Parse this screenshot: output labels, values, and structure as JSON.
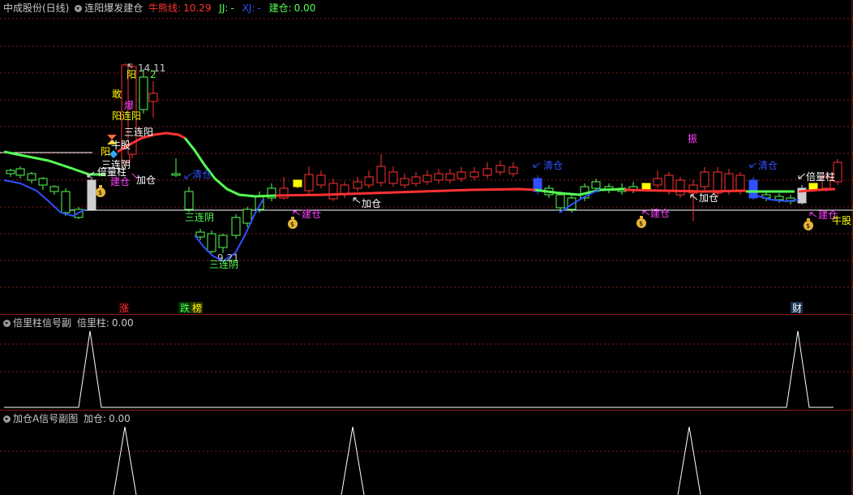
{
  "main": {
    "stock_name": "中成股份(日线)",
    "indicator_name": "连阳爆发建仓",
    "niu_label": "牛熊线:",
    "niu_value": "10.29",
    "jj_label": "JJ:",
    "jj_value": "-",
    "xj_label": "XJ:",
    "xj_value": "-",
    "jiancang_label": "建仓:",
    "jiancang_value": "0.00",
    "price_high_label": "14.11",
    "price_low_label": "9.21",
    "annotations": {
      "lian_yang": "三连阳",
      "lian_yin": "三连阴",
      "niu_gu": "牛股",
      "yang": "阳",
      "bei_liang_zhu": "倍量柱",
      "jian_cang": "建仓",
      "jia_cang": "加仓",
      "qing_cang": "清仓",
      "zhen": "振",
      "bao": "爆",
      "gan": "敢",
      "yang_lian_yang": "阳连阳",
      "er": "2",
      "yang_char": "阳"
    },
    "bottom_tags": {
      "zhang": "涨",
      "die": "跌",
      "bang": "榜",
      "cai": "财"
    },
    "colors": {
      "up": "#ff3232",
      "down": "#54ff54",
      "blue": "#3050ff",
      "yellow": "#ffff00",
      "magenta": "#ff40ff",
      "white": "#ffffff",
      "grid": "#8a1a1a"
    }
  },
  "sub1": {
    "name": "倍里柱信号副",
    "value_label": "倍里柱:",
    "value": "0.00"
  },
  "sub2": {
    "name": "加仓A信号副图",
    "value_label": "加仓:",
    "value": "0.00"
  }
}
